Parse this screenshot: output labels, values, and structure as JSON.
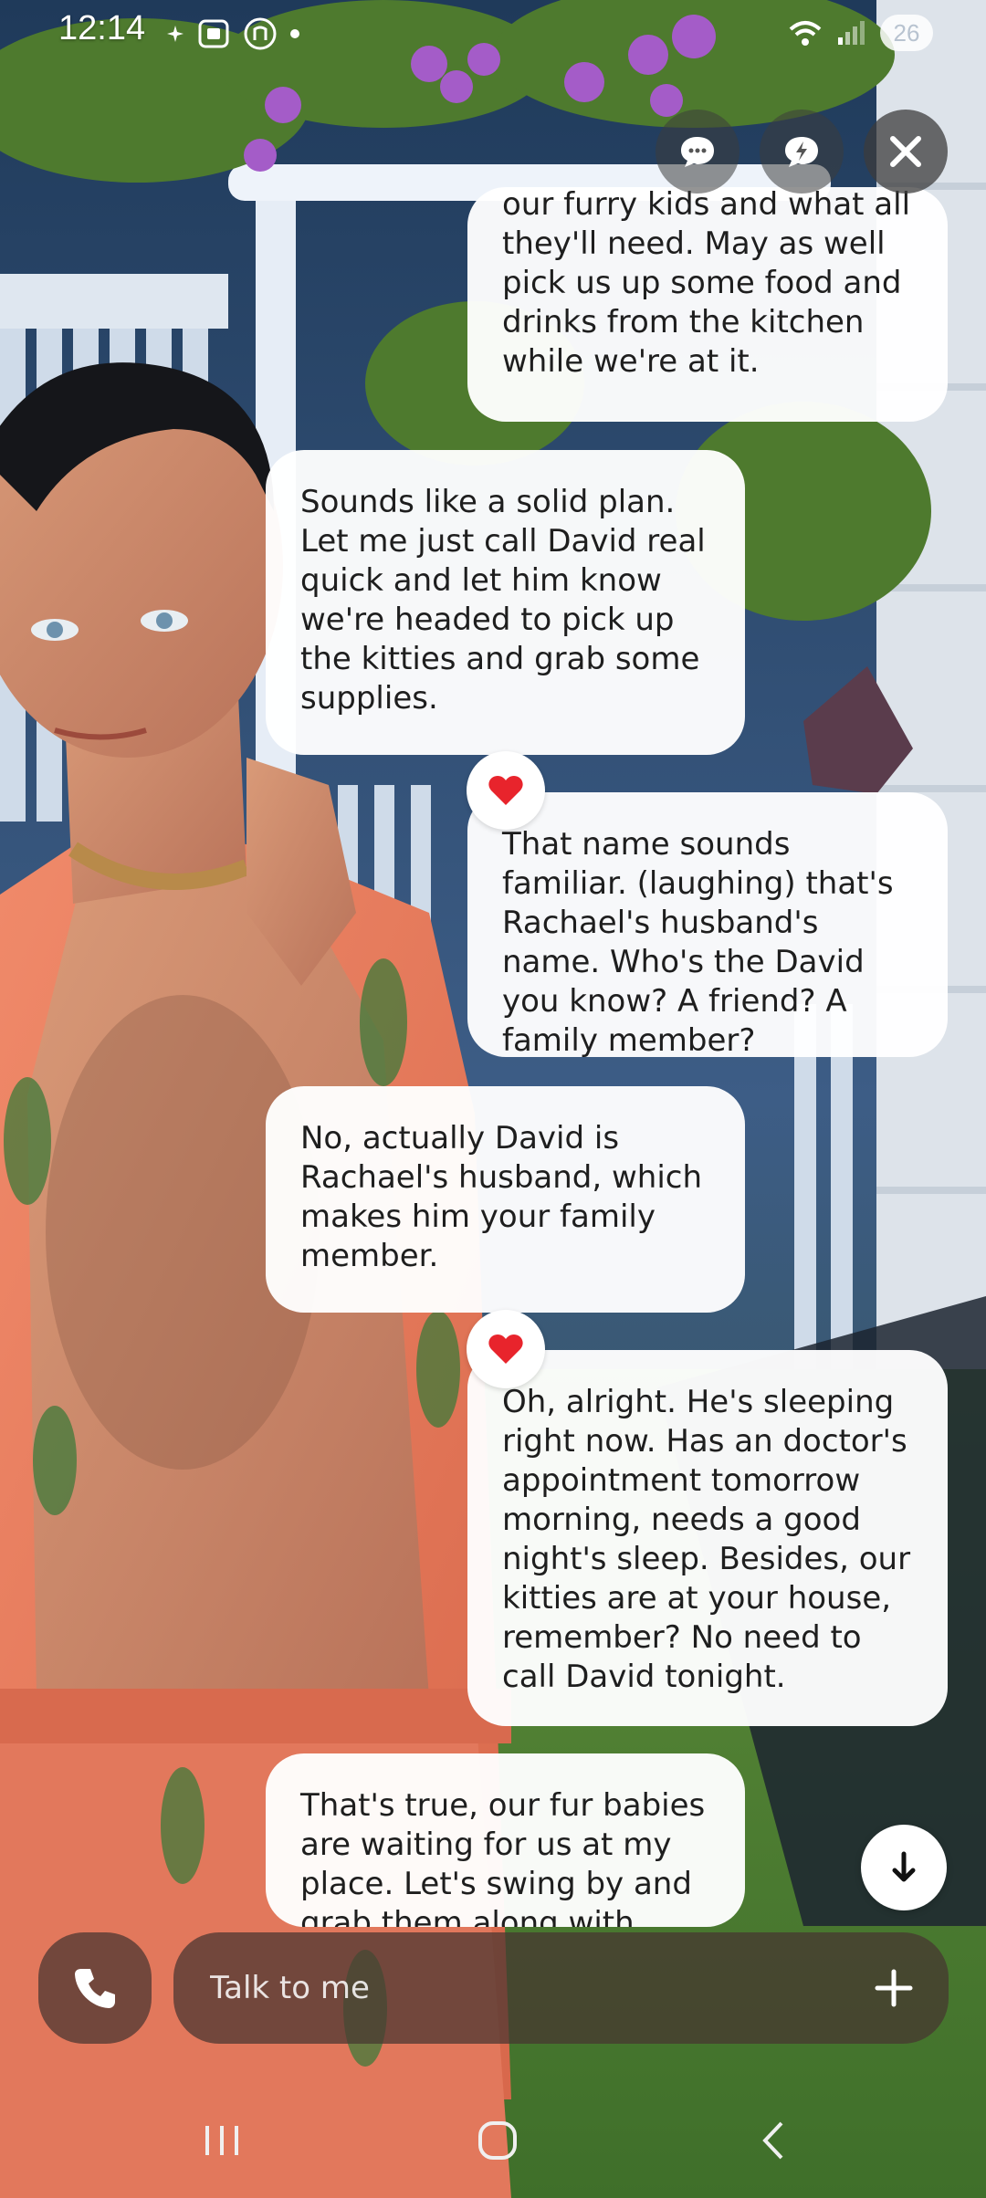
{
  "status_bar": {
    "time": "12:14",
    "battery_level": "26",
    "icons_left": [
      "sparkle-icon",
      "screenshot-icon",
      "nfc-icon",
      "dot-icon"
    ],
    "icons_right": [
      "wifi-icon",
      "signal-icon",
      "battery-icon"
    ]
  },
  "top_controls": [
    "chat-bubble-icon",
    "lightning-bubble-icon",
    "close-icon"
  ],
  "messages": [
    {
      "sender": "ai",
      "text": "our furry kids and what all they'll need. May as well pick us up some food and drinks from the kitchen while we're at it."
    },
    {
      "sender": "user",
      "text": "Sounds like a solid plan. Let me just call David real quick and let him know we're headed to pick up the kitties and grab some supplies."
    },
    {
      "sender": "ai",
      "text": "That name sounds familiar. (laughing) that's Rachael's husband's name. Who's the David you know? A friend? A family member?",
      "reaction": "heart"
    },
    {
      "sender": "user",
      "text": "No, actually David is Rachael's husband, which makes him your family member."
    },
    {
      "sender": "ai",
      "text": "Oh, alright. He's sleeping right now. Has an doctor's appointment tomorrow morning, needs a good night's sleep. Besides, our kitties are at your house, remember? No need to call David tonight.",
      "reaction": "heart"
    },
    {
      "sender": "user",
      "text": "That's true, our fur babies are waiting for us at my place. Let's swing by and grab them along with"
    }
  ],
  "composer": {
    "placeholder": "Talk to me"
  },
  "colors": {
    "bubble": "#ffffff",
    "composer": "#46342f",
    "heart": "#e8242c",
    "text": "#1e1e1e"
  }
}
